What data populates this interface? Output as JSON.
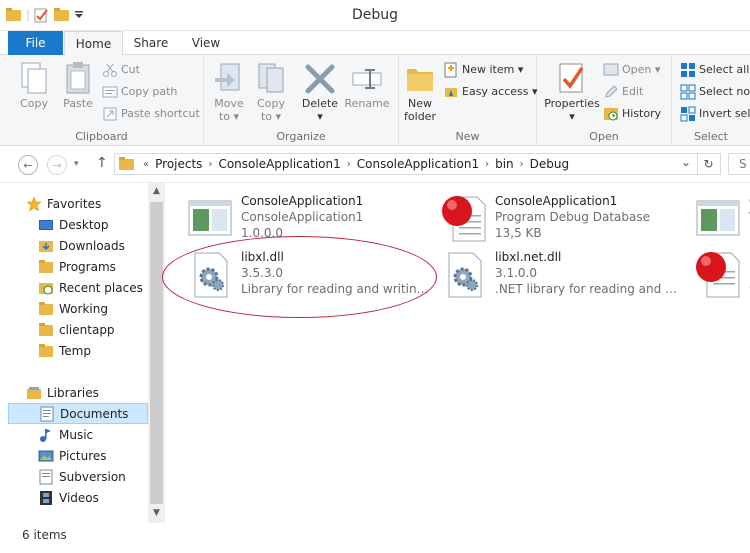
{
  "window": {
    "title": "Debug"
  },
  "tabs": [
    {
      "label": "File"
    },
    {
      "label": "Home"
    },
    {
      "label": "Share"
    },
    {
      "label": "View"
    }
  ],
  "ribbon": {
    "clipboard": {
      "label": "Clipboard",
      "copy": "Copy",
      "paste": "Paste",
      "cut": "Cut",
      "copy_path": "Copy path",
      "paste_shortcut": "Paste shortcut"
    },
    "organize": {
      "label": "Organize",
      "move_to": "Move",
      "move_to_2": "to ▾",
      "copy_to": "Copy",
      "copy_to_2": "to ▾",
      "delete": "Delete",
      "delete_2": "▾",
      "rename": "Rename"
    },
    "new": {
      "label": "New",
      "new_folder": "New",
      "new_folder_2": "folder",
      "new_item": "New item ▾",
      "easy_access": "Easy access ▾"
    },
    "open": {
      "label": "Open",
      "properties": "Properties",
      "properties_2": "▾",
      "open": "Open ▾",
      "edit": "Edit",
      "history": "History"
    },
    "select": {
      "label": "Select",
      "select_all": "Select all",
      "select_none": "Select nor",
      "invert": "Invert sele"
    }
  },
  "address": {
    "back": "←",
    "forward": "→",
    "up": "↑",
    "prefix": "«",
    "crumbs": [
      "Projects",
      "ConsoleApplication1",
      "ConsoleApplication1",
      "bin",
      "Debug"
    ],
    "dropdown": "⌄",
    "refresh": "↻",
    "search": "S"
  },
  "navpane": {
    "favorites": "Favorites",
    "favorites_items": [
      "Desktop",
      "Downloads",
      "Programs",
      "Recent places",
      "Working",
      "clientapp",
      "Temp"
    ],
    "libraries": "Libraries",
    "libraries_items": [
      "Documents",
      "Music",
      "Pictures",
      "Subversion",
      "Videos"
    ]
  },
  "files": [
    {
      "name": "ConsoleApplication1",
      "line2": "ConsoleApplication1",
      "line3": "1.0.0.0",
      "icon": "application-icon"
    },
    {
      "name": "ConsoleApplication1",
      "line2": "Program Debug Database",
      "line3": "13,5 KB",
      "icon": "pdb-icon"
    },
    {
      "name": "C",
      "line2": "V",
      "line3": "M",
      "icon": "application-icon"
    },
    {
      "name": "libxl.dll",
      "line2": "3.5.3.0",
      "line3": "Library for reading and writing Ex...",
      "icon": "dll-gear-icon"
    },
    {
      "name": "libxl.net.dll",
      "line2": "3.1.0.0",
      "line3": ".NET library for reading and writin...",
      "icon": "dll-gear-icon"
    },
    {
      "name": "l",
      "line2": "F",
      "line3": "9",
      "icon": "pdb-icon"
    }
  ],
  "status": {
    "items": "6 items"
  },
  "colors": {
    "accent": "#1979ca",
    "selected": "#cce8ff",
    "annotation": "#b52a3b"
  }
}
